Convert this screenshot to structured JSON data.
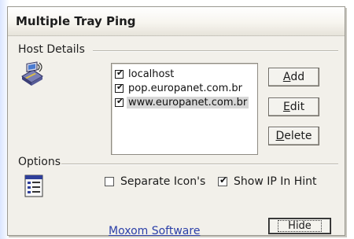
{
  "window": {
    "title": "Multiple Tray Ping"
  },
  "host_details": {
    "label": "Host Details",
    "icon": "network-computer-icon",
    "hosts": [
      {
        "name": "localhost",
        "checked": true,
        "selected": false
      },
      {
        "name": "pop.europanet.com.br",
        "checked": true,
        "selected": false
      },
      {
        "name": "www.europanet.com.br",
        "checked": true,
        "selected": true
      }
    ]
  },
  "buttons": {
    "add": {
      "mnemonic": "A",
      "rest": "dd"
    },
    "edit": {
      "mnemonic": "E",
      "rest": "dit"
    },
    "delete": {
      "mnemonic": "D",
      "rest": "elete"
    },
    "hide": "Hide"
  },
  "options": {
    "label": "Options",
    "icon": "checklist-icon",
    "separate_icons": {
      "label": "Separate Icon's",
      "checked": false
    },
    "show_ip_in_hint": {
      "label": "Show IP In Hint",
      "checked": true
    }
  },
  "footer": {
    "link": "Moxom Software"
  },
  "colors": {
    "window_bg": "#f2f0ea",
    "link": "#2b3fa8",
    "selection": "#d7d7d7"
  }
}
